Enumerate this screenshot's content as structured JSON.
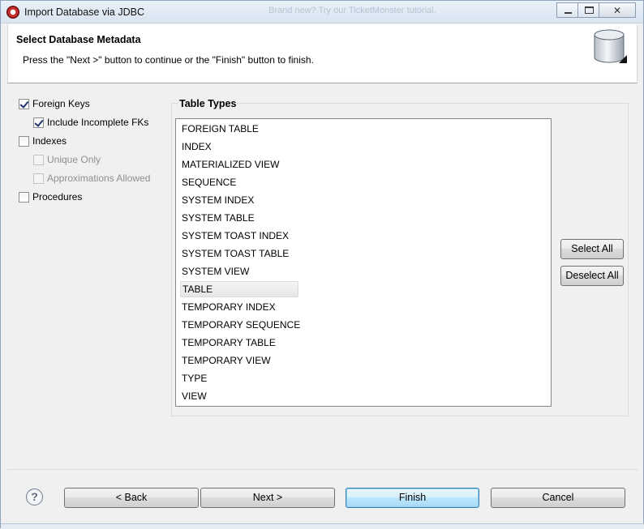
{
  "window": {
    "title": "Import Database via JDBC",
    "background_hint": "Brand new? Try our TicketMonster tutorial."
  },
  "header": {
    "title": "Select Database Metadata",
    "description": "Press the \"Next >\" button to continue or the \"Finish\" button to finish."
  },
  "options": {
    "foreign_keys": {
      "label": "Foreign Keys",
      "checked": true,
      "enabled": true
    },
    "include_incomplete_fks": {
      "label": "Include Incomplete FKs",
      "checked": true,
      "enabled": true
    },
    "indexes": {
      "label": "Indexes",
      "checked": false,
      "enabled": true
    },
    "unique_only": {
      "label": "Unique Only",
      "checked": false,
      "enabled": false
    },
    "approximations_allowed": {
      "label": "Approximations Allowed",
      "checked": false,
      "enabled": false
    },
    "procedures": {
      "label": "Procedures",
      "checked": false,
      "enabled": true
    }
  },
  "table_types": {
    "title": "Table Types",
    "selected": "TABLE",
    "items": [
      "FOREIGN TABLE",
      "INDEX",
      "MATERIALIZED VIEW",
      "SEQUENCE",
      "SYSTEM INDEX",
      "SYSTEM TABLE",
      "SYSTEM TOAST INDEX",
      "SYSTEM TOAST TABLE",
      "SYSTEM VIEW",
      "TABLE",
      "TEMPORARY INDEX",
      "TEMPORARY SEQUENCE",
      "TEMPORARY TABLE",
      "TEMPORARY VIEW",
      "TYPE",
      "VIEW"
    ],
    "select_all_label": "Select All",
    "deselect_all_label": "Deselect All"
  },
  "footer": {
    "help_symbol": "?",
    "back_label": "< Back",
    "next_label": "Next >",
    "finish_label": "Finish",
    "cancel_label": "Cancel"
  },
  "colors": {
    "dialog_bg": "#f0f0f0",
    "default_button": "#bee6fd",
    "window_chrome": "#d9e4f1"
  },
  "icons": {
    "app": "eclipse-jboss-icon",
    "database": "database-cylinder-icon",
    "help": "help-icon"
  }
}
